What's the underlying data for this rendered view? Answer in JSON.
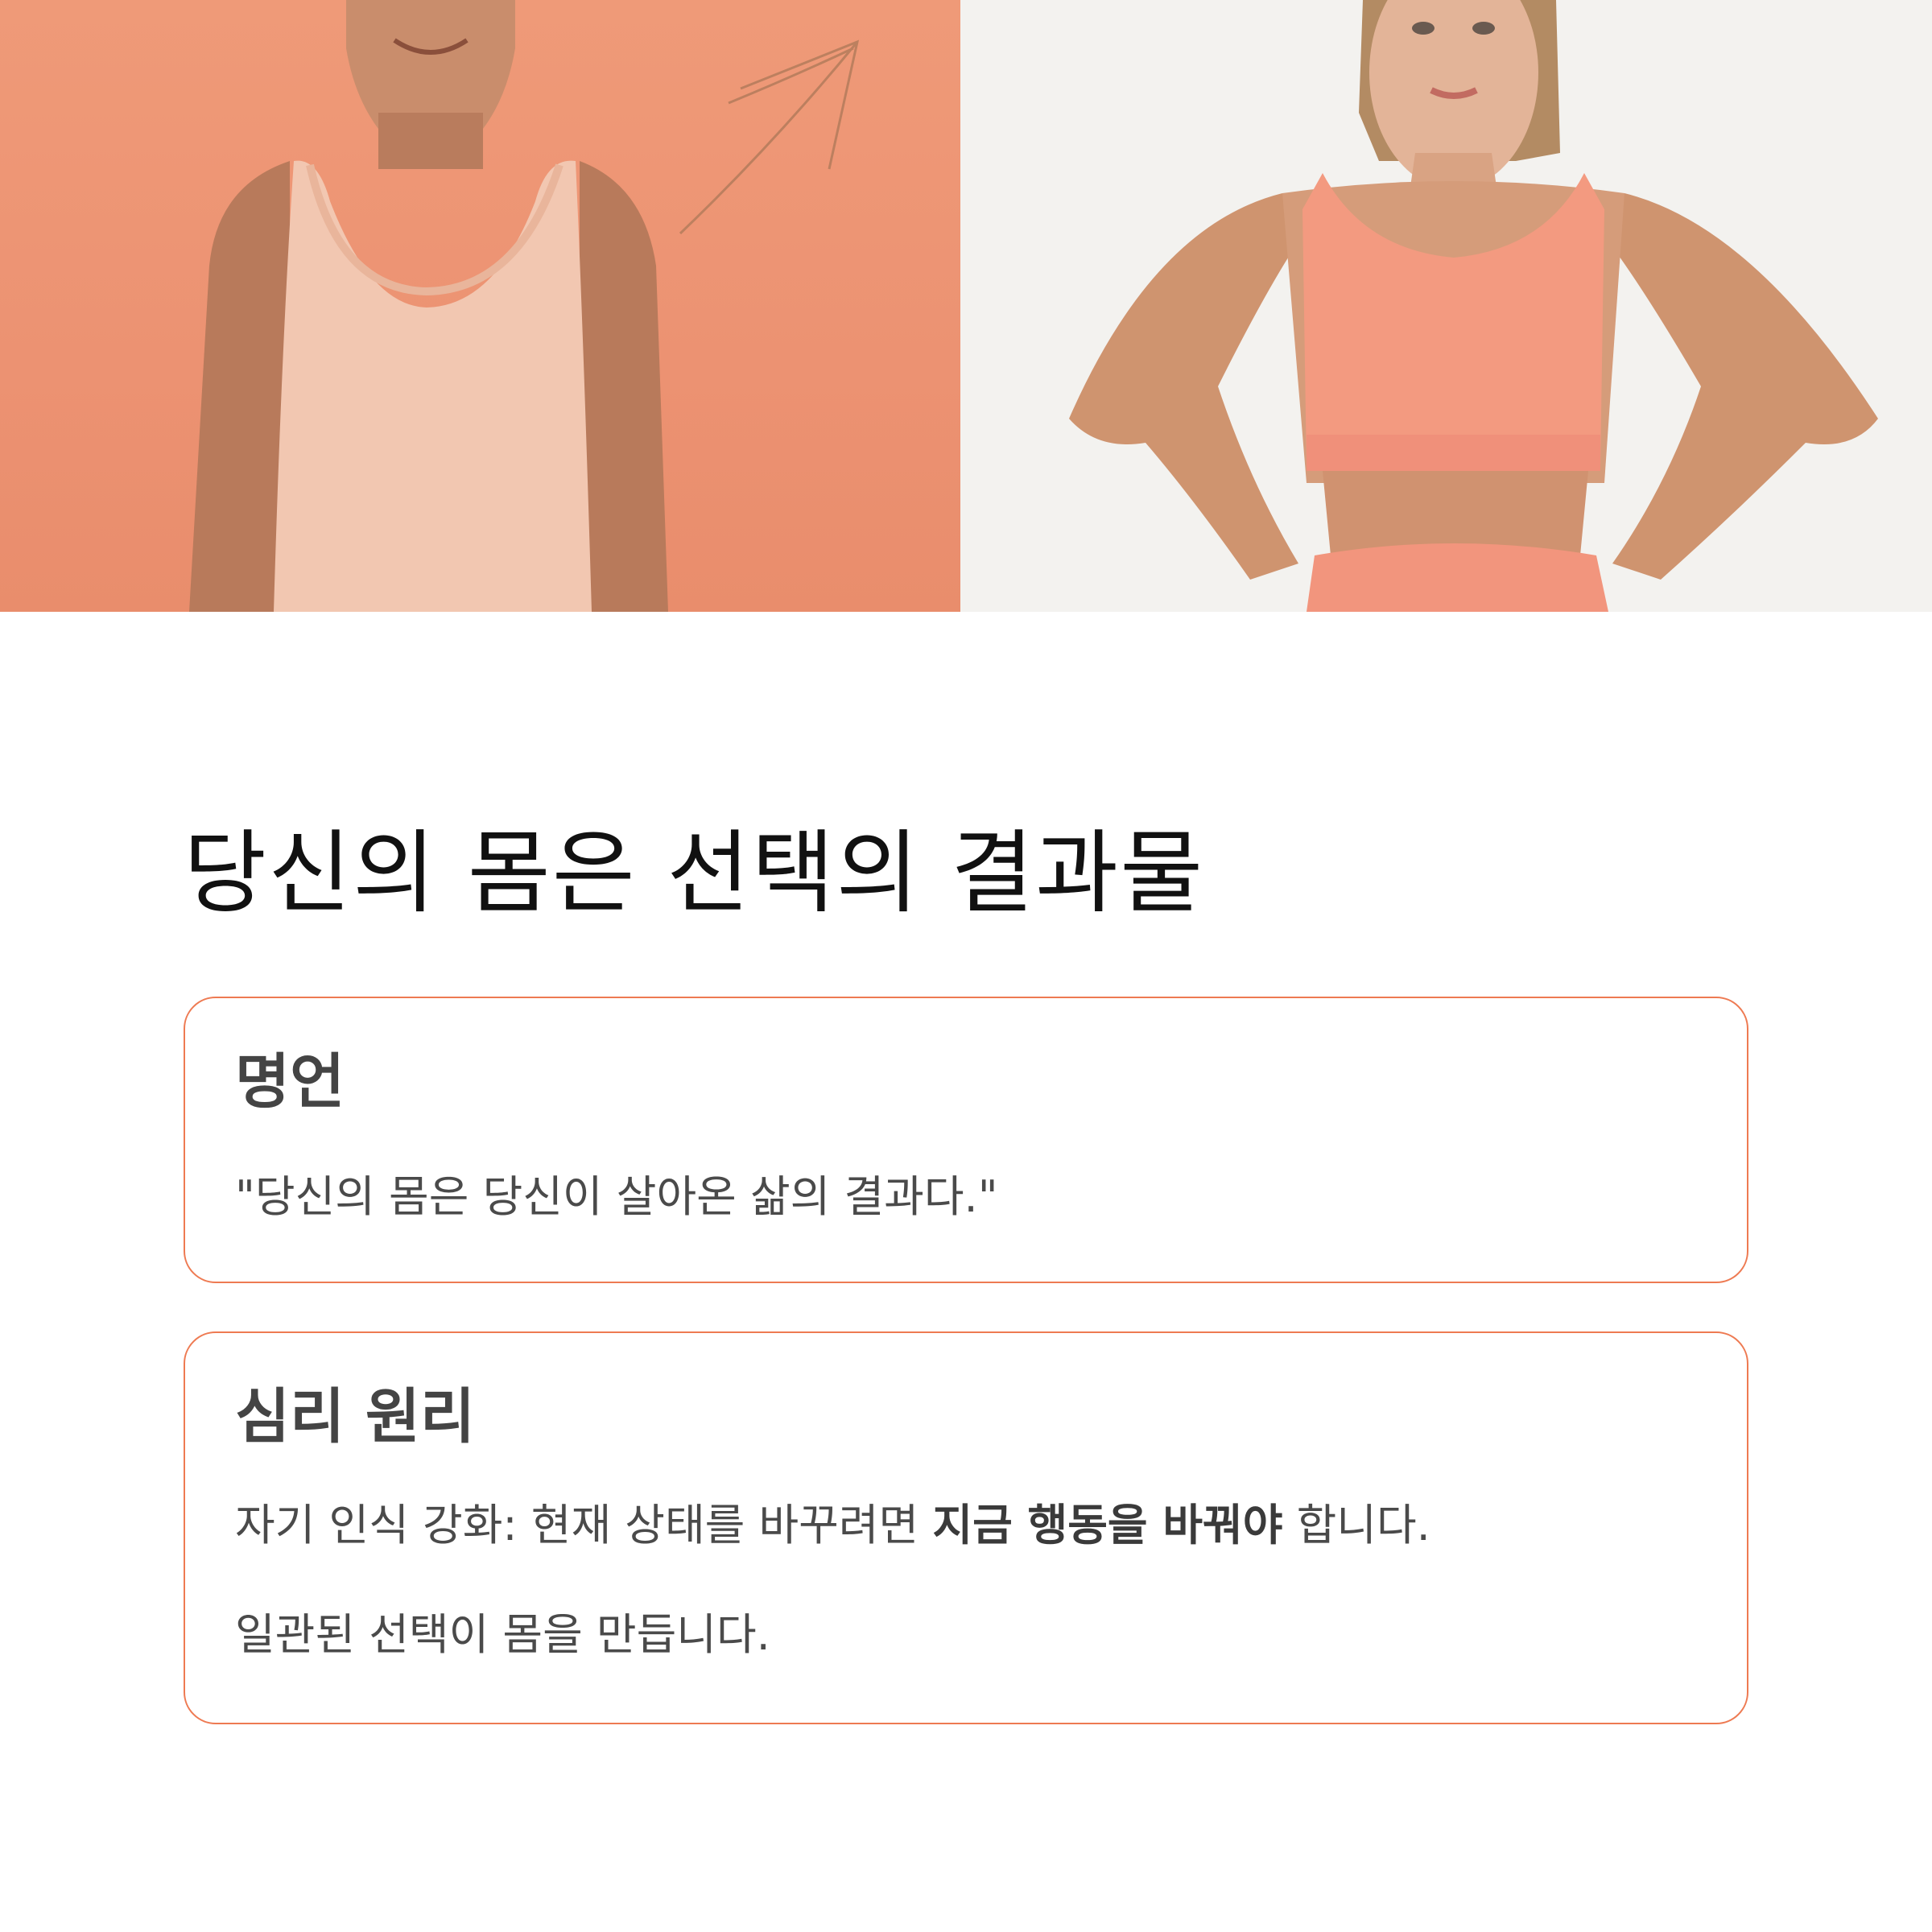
{
  "hero": {
    "left_photo": "thin young man in sleeveless tank top against orange background with arrow",
    "right_photo": "fit woman in coral sports bra with hands on hips against light background",
    "colors": {
      "left_bg": "#ec9272",
      "right_bg": "#f3f2ef",
      "apparel": "#f39a80"
    }
  },
  "title": "당신의 몸은 선택의 결과물",
  "quote_card": {
    "heading": "명언",
    "text": "\"당신의 몸은 당신이 살아온 삶의 결과다.\""
  },
  "principle_card": {
    "heading": "심리 원리",
    "line1_before": "자기 인식 강화: 현재 상태를 바꾸려면 ",
    "line1_bold": "지금 행동을 바꿔야",
    "line1_after": " 합니다.",
    "line2": "일관된 선택이 몸을 만듭니다."
  },
  "colors": {
    "accent_border": "#ee7a52",
    "title": "#111111",
    "text": "#4a4a4a"
  }
}
